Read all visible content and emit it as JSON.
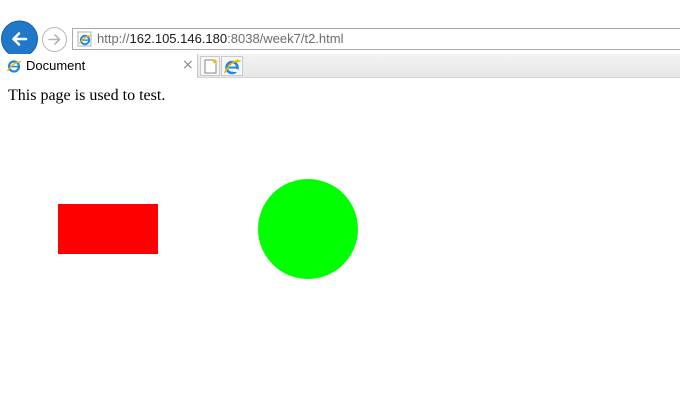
{
  "browser": {
    "address": {
      "scheme": "http://",
      "host": "162.105.146.180",
      "rest": ":8038/week7/t2.html"
    },
    "tabs": [
      {
        "title": "Document",
        "close_glyph": "×"
      }
    ],
    "icons": {
      "back": "back-arrow-icon",
      "forward": "forward-arrow-icon",
      "page": "ie-page-icon",
      "new_tab": "new-tab-icon",
      "ie_logo": "ie-logo-icon"
    },
    "colors": {
      "back_button": "#1f78c8"
    }
  },
  "page": {
    "text": "This page is used to test.",
    "shapes": {
      "rectangle_color": "#ff0000",
      "circle_color": "#00ff00"
    }
  }
}
